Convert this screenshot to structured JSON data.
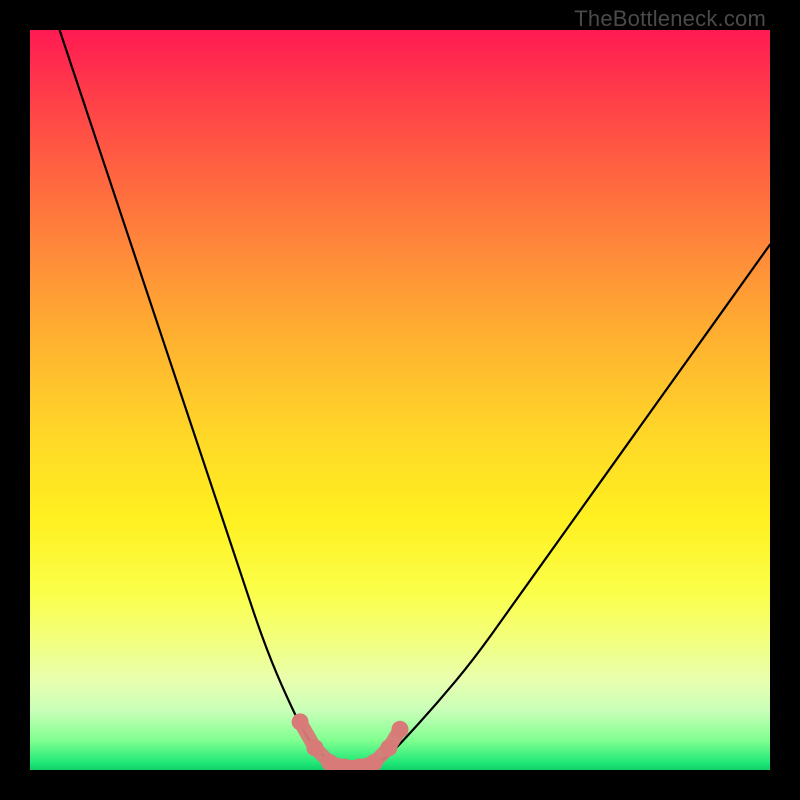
{
  "watermark": "TheBottleneck.com",
  "chart_data": {
    "type": "line",
    "title": "",
    "xlabel": "",
    "ylabel": "",
    "xlim": [
      0,
      100
    ],
    "ylim_pct_from_top": [
      0,
      100
    ],
    "series": [
      {
        "name": "bottleneck-curve",
        "x": [
          4,
          8,
          12,
          16,
          20,
          24,
          28,
          32,
          36,
          38,
          40,
          42,
          44,
          46,
          48,
          50,
          55,
          60,
          65,
          70,
          75,
          80,
          85,
          90,
          95,
          100
        ],
        "y_pct_from_top": [
          0,
          12,
          24,
          36,
          48,
          60,
          72,
          84,
          93,
          96.5,
          98.5,
          99.5,
          99.7,
          99.5,
          98.5,
          96.5,
          91,
          85,
          78,
          71,
          64,
          57,
          50,
          43,
          36,
          29
        ]
      }
    ],
    "markers": {
      "name": "bottom-highlight",
      "color": "#d87a78",
      "points": [
        {
          "x": 36.5,
          "y_pct_from_top": 93.5
        },
        {
          "x": 38.5,
          "y_pct_from_top": 97
        },
        {
          "x": 40.5,
          "y_pct_from_top": 99
        },
        {
          "x": 42.5,
          "y_pct_from_top": 99.6
        },
        {
          "x": 44.5,
          "y_pct_from_top": 99.6
        },
        {
          "x": 46.5,
          "y_pct_from_top": 99
        },
        {
          "x": 48.5,
          "y_pct_from_top": 97
        },
        {
          "x": 50.0,
          "y_pct_from_top": 94.5
        }
      ]
    }
  }
}
